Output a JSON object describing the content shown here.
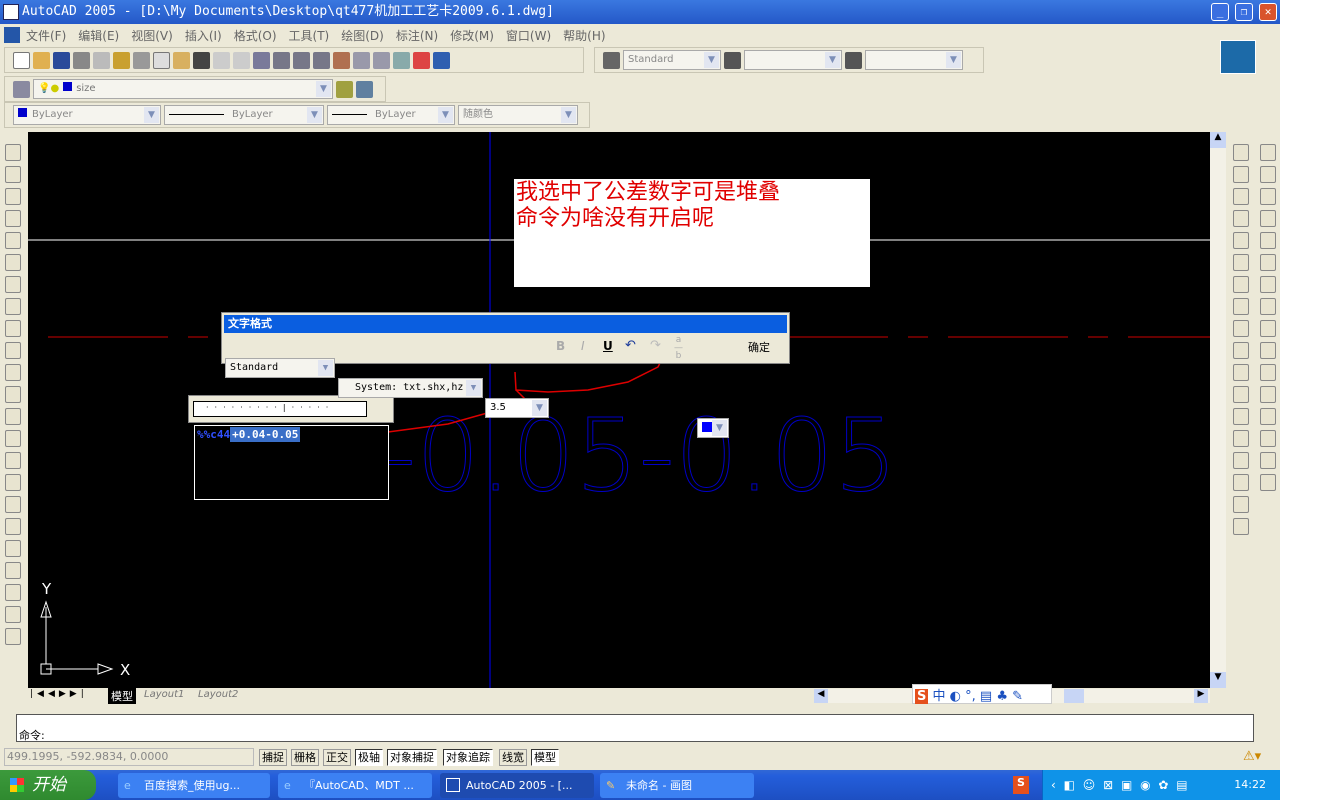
{
  "window": {
    "title": "AutoCAD 2005 - [D:\\My Documents\\Desktop\\qt477机加工工艺卡2009.6.1.dwg]",
    "minimize": "_",
    "restore": "❐",
    "close": "✕"
  },
  "menu": [
    "文件(F)",
    "编辑(E)",
    "视图(V)",
    "插入(I)",
    "格式(O)",
    "工具(T)",
    "绘图(D)",
    "标注(N)",
    "修改(M)",
    "窗口(W)",
    "帮助(H)"
  ],
  "toolbar": {
    "text_style": "Standard"
  },
  "layers": {
    "current_layer": "size"
  },
  "properties": {
    "color": "ByLayer",
    "linetype": "ByLayer",
    "lineweight": "ByLayer",
    "plotstyle": "随颜色"
  },
  "annotation": {
    "line1": "我选中了公差数字可是堆叠",
    "line2": "命令为啥没有开启呢"
  },
  "text_format": {
    "title": "文字格式",
    "style": "Standard",
    "font": "System: txt.shx,hz",
    "height": "3.5",
    "bold": "B",
    "italic": "I",
    "underline": "U",
    "ok": "确定",
    "stack_enabled": false
  },
  "mtext": {
    "prefix": "%%c44",
    "selected": "+0.04-0.05"
  },
  "drawing": {
    "big_text": "-0.05-0.05",
    "colors": {
      "text": "#0000c8",
      "annotation": "#e00000",
      "crosshair": "#0000ff"
    }
  },
  "ucs": {
    "x": "X",
    "y": "Y"
  },
  "tabs": [
    "模型",
    "Layout1",
    "Layout2"
  ],
  "ime": {
    "label": "中"
  },
  "command": {
    "prompt": "命令:"
  },
  "status": {
    "coords": "499.1995, -592.9834, 0.0000",
    "toggles": [
      {
        "label": "捕捉",
        "on": false
      },
      {
        "label": "栅格",
        "on": false
      },
      {
        "label": "正交",
        "on": false
      },
      {
        "label": "极轴",
        "on": true
      },
      {
        "label": "对象捕捉",
        "on": true
      },
      {
        "label": "对象追踪",
        "on": true
      },
      {
        "label": "线宽",
        "on": false
      },
      {
        "label": "模型",
        "on": true
      }
    ]
  },
  "taskbar": {
    "start": "开始",
    "tasks": [
      "百度搜索_使用ug...",
      "『AutoCAD、MDT ...",
      "AutoCAD 2005 - [...",
      "未命名 - 画图"
    ],
    "active": 2,
    "clock": "14:22"
  }
}
